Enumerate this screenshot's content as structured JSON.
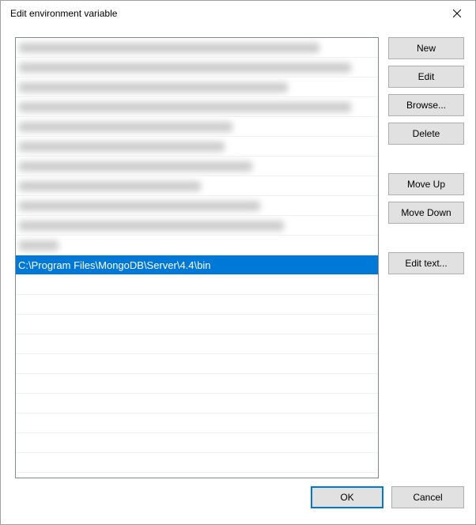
{
  "titlebar": {
    "title": "Edit environment variable"
  },
  "list": {
    "selected_value": "C:\\Program Files\\MongoDB\\Server\\4.4\\bin"
  },
  "buttons": {
    "new": "New",
    "edit": "Edit",
    "browse": "Browse...",
    "delete": "Delete",
    "move_up": "Move Up",
    "move_down": "Move Down",
    "edit_text": "Edit text...",
    "ok": "OK",
    "cancel": "Cancel"
  }
}
